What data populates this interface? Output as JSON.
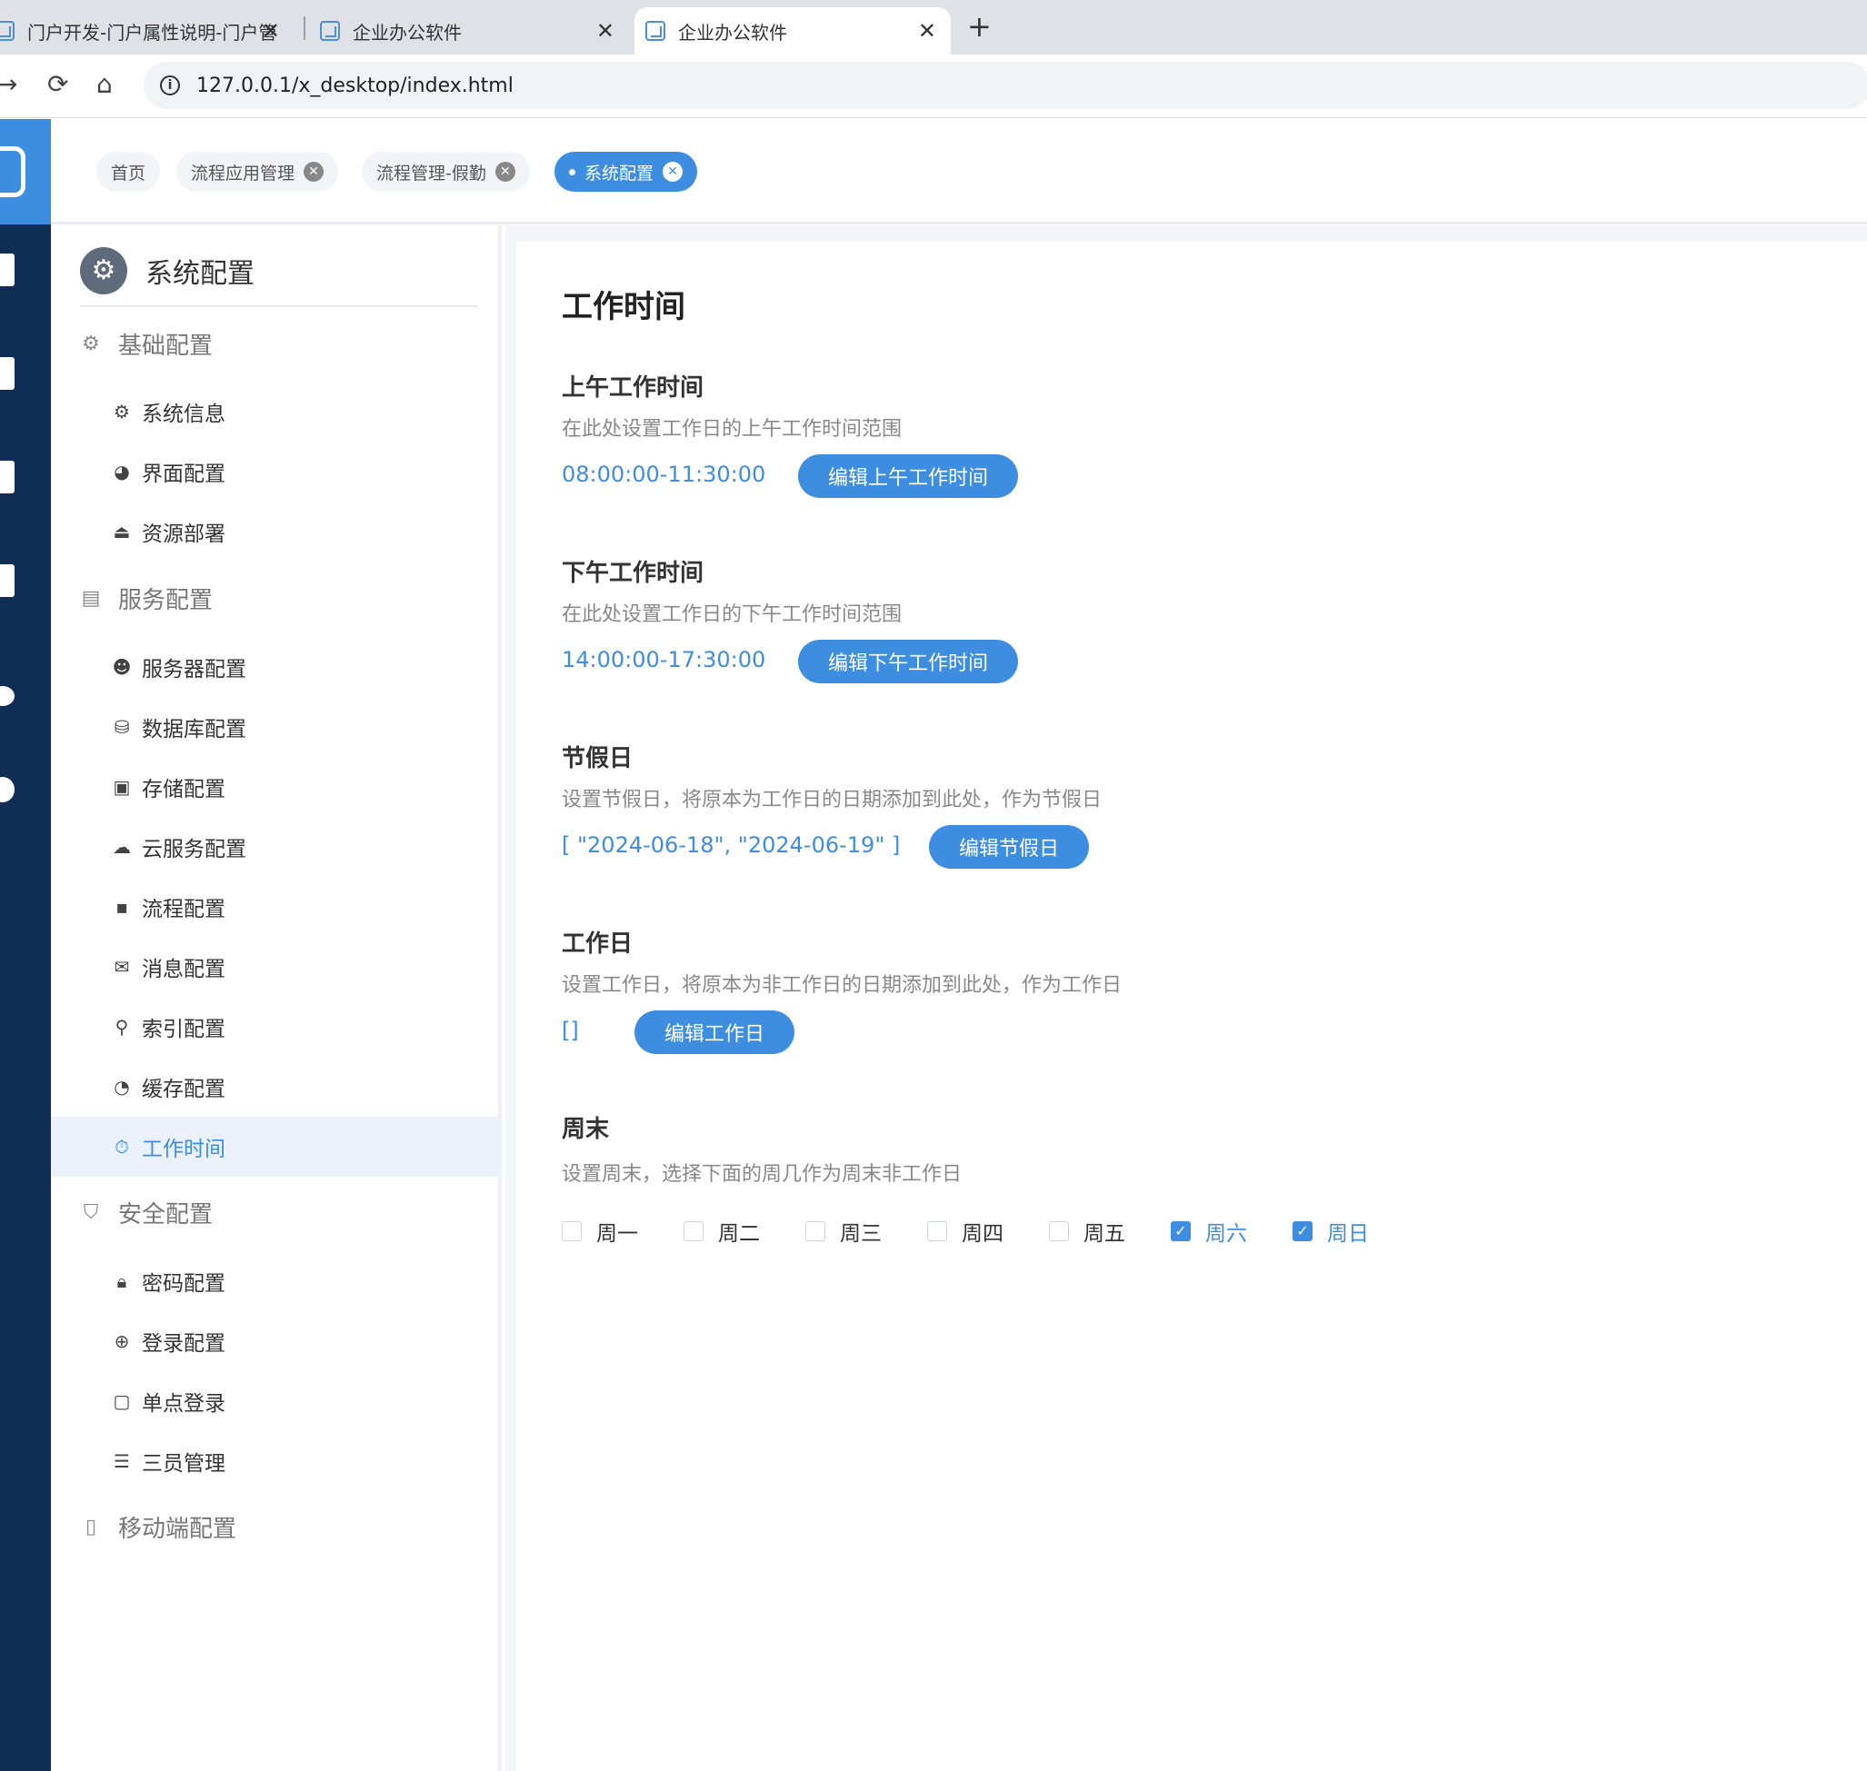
{
  "browser": {
    "tabs": [
      {
        "title": "门户开发-门户属性说明-门户管"
      },
      {
        "title": "企业办公软件"
      },
      {
        "title": "企业办公软件"
      }
    ],
    "close_glyph": "✕",
    "new_tab_glyph": "+",
    "url": "127.0.0.1/x_desktop/index.html",
    "nav": {
      "forward": "→",
      "reload": "⟳",
      "home": "⌂"
    }
  },
  "breadcrumbs": [
    {
      "label": "首页"
    },
    {
      "label": "流程应用管理"
    },
    {
      "label": "流程管理-假勤"
    },
    {
      "label": "系统配置"
    }
  ],
  "chip_close_glyph": "✕",
  "sidebar": {
    "title": "系统配置",
    "groups": [
      {
        "label": "基础配置",
        "icon": "gear-icon",
        "items": [
          {
            "label": "系统信息",
            "icon": "gear-icon"
          },
          {
            "label": "界面配置",
            "icon": "palette-icon"
          },
          {
            "label": "资源部署",
            "icon": "upload-icon"
          }
        ]
      },
      {
        "label": "服务配置",
        "icon": "server-icon",
        "items": [
          {
            "label": "服务器配置",
            "icon": "server-user-icon"
          },
          {
            "label": "数据库配置",
            "icon": "database-icon"
          },
          {
            "label": "存储配置",
            "icon": "archive-icon"
          },
          {
            "label": "云服务配置",
            "icon": "cloud-icon"
          },
          {
            "label": "流程配置",
            "icon": "flow-icon"
          },
          {
            "label": "消息配置",
            "icon": "message-icon"
          },
          {
            "label": "索引配置",
            "icon": "search-icon"
          },
          {
            "label": "缓存配置",
            "icon": "pie-icon"
          },
          {
            "label": "工作时间",
            "icon": "stopwatch-icon"
          }
        ]
      },
      {
        "label": "安全配置",
        "icon": "shield-icon",
        "items": [
          {
            "label": "密码配置",
            "icon": "lock-icon"
          },
          {
            "label": "登录配置",
            "icon": "login-icon"
          },
          {
            "label": "单点登录",
            "icon": "badge-icon"
          },
          {
            "label": "三员管理",
            "icon": "list-icon"
          }
        ]
      },
      {
        "label": "移动端配置",
        "icon": "mobile-icon",
        "items": []
      }
    ]
  },
  "main": {
    "title": "工作时间",
    "sections": [
      {
        "title": "上午工作时间",
        "desc": "在此处设置工作日的上午工作时间范围",
        "value": "08:00:00-11:30:00",
        "button": "编辑上午工作时间"
      },
      {
        "title": "下午工作时间",
        "desc": "在此处设置工作日的下午工作时间范围",
        "value": "14:00:00-17:30:00",
        "button": "编辑下午工作时间"
      },
      {
        "title": "节假日",
        "desc": "设置节假日，将原本为工作日的日期添加到此处，作为节假日",
        "value": "[ \"2024-06-18\", \"2024-06-19\" ]",
        "button": "编辑节假日"
      },
      {
        "title": "工作日",
        "desc": "设置工作日，将原本为非工作日的日期添加到此处，作为工作日",
        "value": "[]",
        "button": "编辑工作日"
      }
    ],
    "weekend": {
      "title": "周末",
      "desc": "设置周末，选择下面的周几作为周末非工作日",
      "check_glyph": "✓",
      "days": [
        {
          "label": "周一",
          "checked": false
        },
        {
          "label": "周二",
          "checked": false
        },
        {
          "label": "周三",
          "checked": false
        },
        {
          "label": "周四",
          "checked": false
        },
        {
          "label": "周五",
          "checked": false
        },
        {
          "label": "周六",
          "checked": true
        },
        {
          "label": "周日",
          "checked": true
        }
      ]
    }
  },
  "colors": {
    "accent": "#3d8de1",
    "rail": "#0f2d55"
  }
}
